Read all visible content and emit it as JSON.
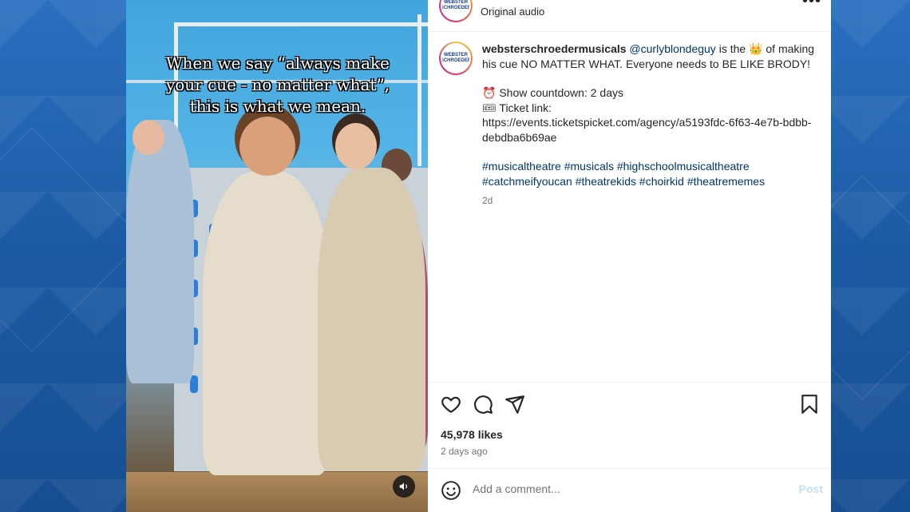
{
  "header": {
    "avatar_text": "WEBSTER SCHROEDER",
    "audio_label": "Original audio",
    "more_label": "•••"
  },
  "media": {
    "caption": "When we say “always make your cue - no matter what”, this is what we mean.",
    "mute_icon": "speaker-icon"
  },
  "post": {
    "username": "websterschroedermusicals",
    "mention": "@curlyblondeguy",
    "text_1": " is the 👑 of making his cue NO MATTER WHAT. Everyone needs to BE LIKE BRODY!",
    "countdown": "⏰ Show countdown: 2 days",
    "ticket_label": "🎟 Ticket link:",
    "ticket_url": "https://events.ticketspicket.com/agency/a5193fdc-6f63-4e7b-bdbb-debdba6b69ae",
    "tags": [
      "#musicaltheatre",
      "#musicals",
      "#highschoolmusicaltheatre",
      "#catchmeifyoucan",
      "#theatrekids",
      "#choirkid",
      "#theatrememes"
    ],
    "time": "2d"
  },
  "actions": {
    "likes": "45,978 likes",
    "ago": "2 days ago",
    "icons": [
      "heart-icon",
      "comment-icon",
      "share-icon",
      "bookmark-icon"
    ]
  },
  "comment_bar": {
    "placeholder": "Add a comment...",
    "post_label": "Post"
  },
  "colors": {
    "link": "#00376b",
    "muted": "#737373",
    "post_button": "#c0dffd",
    "backdrop": "#1f5fa8"
  }
}
